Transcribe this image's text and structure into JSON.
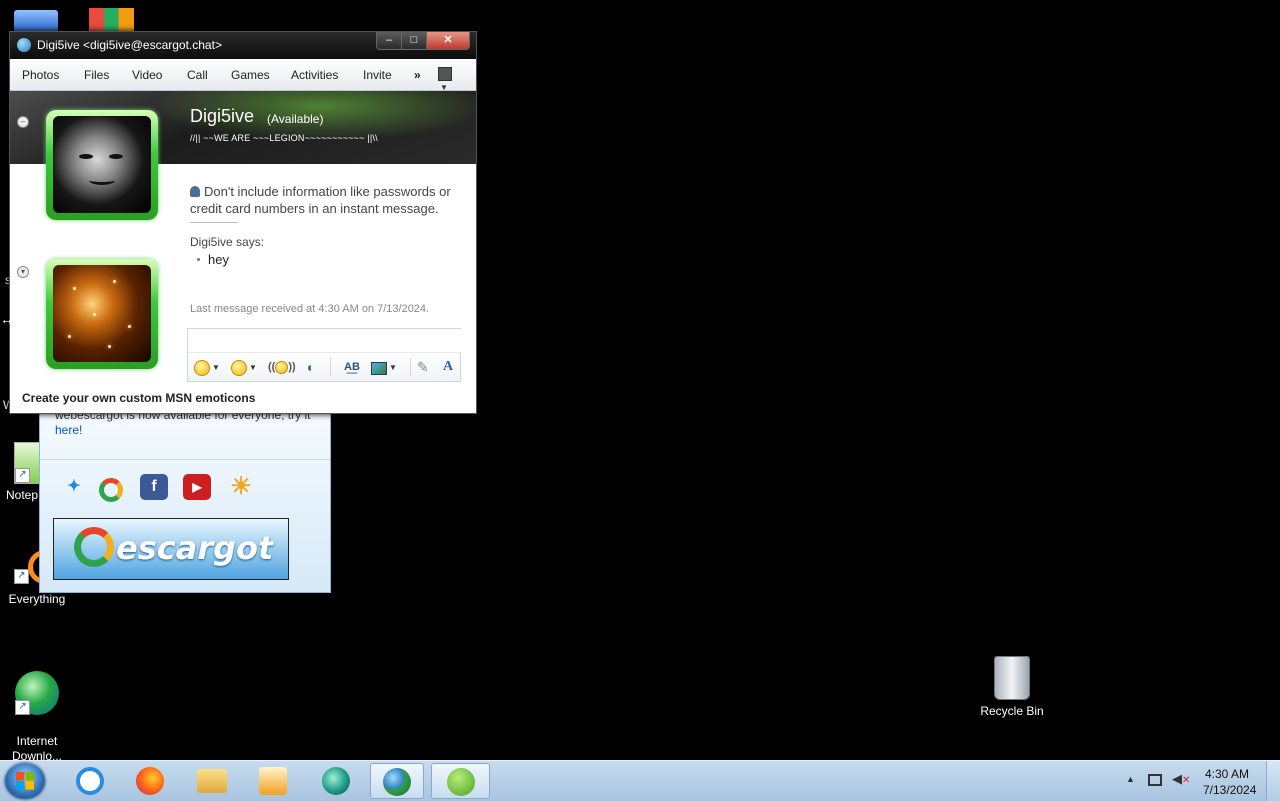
{
  "desktop": {
    "icons": [
      {
        "label": "Notep",
        "name": "notepad"
      },
      {
        "label": "Everything",
        "name": "everything"
      },
      {
        "label": "Internet\nDownlo...",
        "name": "internet-download-manager"
      },
      {
        "label": "Recycle Bin",
        "name": "recycle-bin"
      }
    ],
    "partial_letters": {
      "s": "s",
      "w": "W"
    }
  },
  "contact_list": {
    "notice_text": "webescargot is now available for everyone, try it",
    "notice_link": "here!",
    "services": [
      "msn-butterfly-icon",
      "escargot-icon",
      "facebook-icon",
      "youtube-icon",
      "weather-sun-icon"
    ],
    "banner_text": "escargot"
  },
  "chat": {
    "window_title": "Digi5ive <digi5ive@escargot.chat>",
    "controls": {
      "minimize": "–",
      "maximize": "□",
      "close": "✕"
    },
    "menu": [
      "Photos",
      "Files",
      "Video",
      "Call",
      "Games",
      "Activities",
      "Invite"
    ],
    "more": "»",
    "contact_name": "Digi5ive",
    "contact_status": "(Available)",
    "personal_message": "//|| ~~WE ARE ~~~LEGION~~~~~~~~~~~ ||\\\\",
    "privacy_note": "Don't include information like passwords or credit card numbers in an instant message.",
    "sender_says": "Digi5ive says:",
    "messages": [
      "hey"
    ],
    "last_received": "Last message received at 4:30 AM on 7/13/2024.",
    "input_value": "",
    "toolbar": [
      "emoticon-icon",
      "wink-icon",
      "nudge-icon",
      "voice-clip-icon",
      "font-icon",
      "background-icon",
      "handwriting-icon",
      "text-format-icon"
    ],
    "footer_link": "Create your own custom MSN emoticons"
  },
  "taskbar": {
    "apps": [
      "start-orb",
      "internet-explorer",
      "firefox",
      "file-explorer",
      "media-player",
      "messenger-app",
      "msn-messenger",
      "utorrent"
    ],
    "clock_time": "4:30 AM",
    "clock_date": "7/13/2024"
  },
  "colors": {
    "accent_green": "#3cc93b",
    "taskbar": "#b7cfe6",
    "link": "#0055cc"
  }
}
